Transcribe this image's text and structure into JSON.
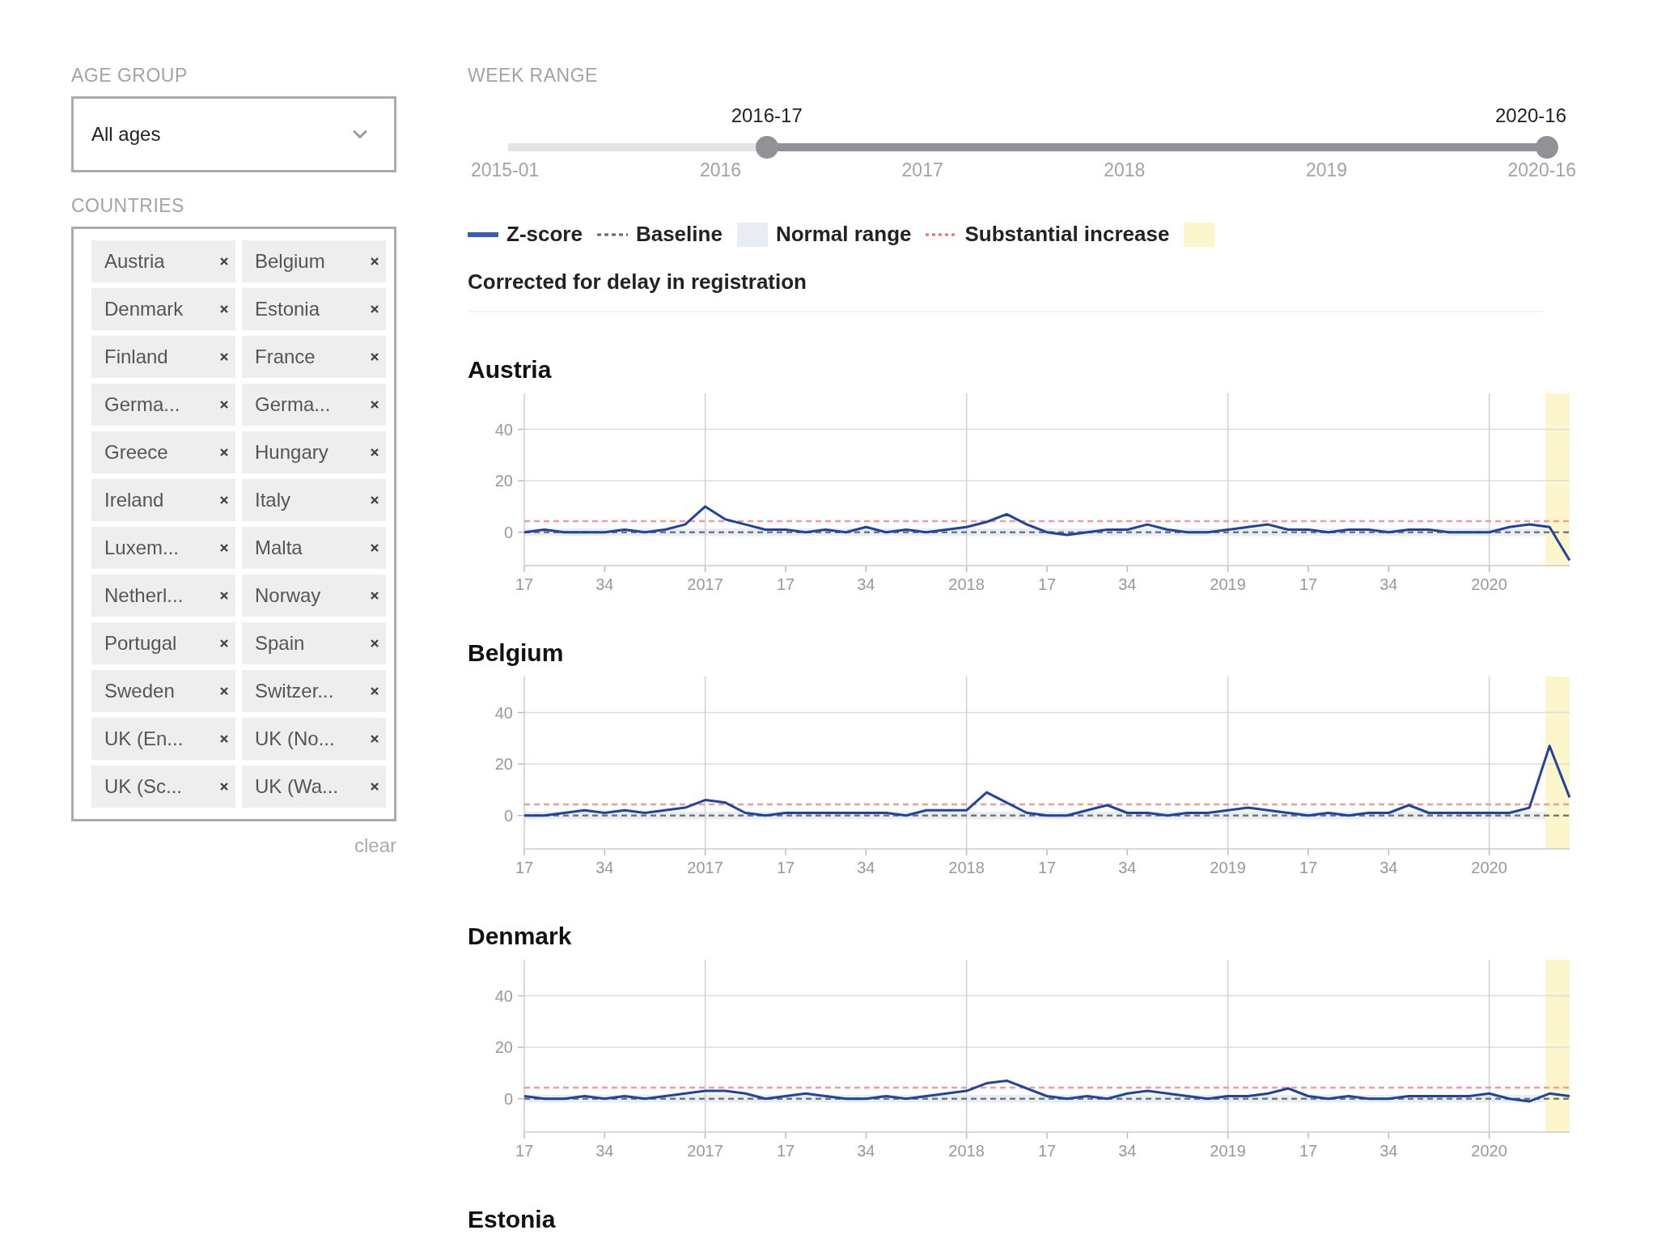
{
  "age_group": {
    "label": "AGE GROUP",
    "value": "All ages"
  },
  "countries": {
    "label": "COUNTRIES",
    "chips": [
      "Austria",
      "Belgium",
      "Denmark",
      "Estonia",
      "Finland",
      "France",
      "Germa...",
      "Germa...",
      "Greece",
      "Hungary",
      "Ireland",
      "Italy",
      "Luxem...",
      "Malta",
      "Netherl...",
      "Norway",
      "Portugal",
      "Spain",
      "Sweden",
      "Switzer...",
      "UK (En...",
      "UK (No...",
      "UK (Sc...",
      "UK (Wa..."
    ],
    "clear": "clear"
  },
  "week_range": {
    "label": "WEEK RANGE",
    "start": {
      "label": "2016-17",
      "level": 0.249
    },
    "end": {
      "label": "2020-16",
      "level": 1
    },
    "ticks": [
      "2015-01",
      "2016",
      "2017",
      "2018",
      "2019",
      "2020-16"
    ]
  },
  "legend": [
    {
      "kind": "line",
      "label": "Z-score",
      "color": "#3a5bb8"
    },
    {
      "kind": "dashed",
      "label": "Baseline",
      "color": "#666666"
    },
    {
      "kind": "swatch",
      "label": "Normal range",
      "color": "#e8edf3"
    },
    {
      "kind": "dotted",
      "label": "Substantial increase",
      "color": "#f06a6a"
    },
    {
      "kind": "swatch",
      "color": "#fdf6cc"
    }
  ],
  "note": "Corrected for delay in registration",
  "panels": [
    {
      "title": "Austria",
      "chart_data": {
        "type": "line",
        "categories": [
          "17",
          null,
          null,
          null,
          "34",
          null,
          null,
          null,
          null,
          "2017",
          null,
          null,
          null,
          "17",
          null,
          null,
          null,
          "34",
          null,
          null,
          null,
          null,
          "2018",
          null,
          null,
          null,
          "17",
          null,
          null,
          null,
          "34",
          null,
          null,
          null,
          null,
          "2019",
          null,
          null,
          null,
          "17",
          null,
          null,
          null,
          "34",
          null,
          null,
          null,
          null,
          "2020",
          null,
          null,
          null,
          null
        ],
        "series": [
          {
            "color": "#1f44a0",
            "values": [
              0,
              1,
              0,
              0,
              0,
              1,
              0,
              1,
              3,
              10,
              5,
              3,
              1,
              1,
              0,
              1,
              0,
              2,
              0,
              1,
              0,
              1,
              2,
              4,
              7,
              3,
              0,
              -1,
              0,
              1,
              1,
              3,
              1,
              0,
              0,
              1,
              2,
              3,
              1,
              1,
              0,
              1,
              1,
              0,
              1,
              1,
              0,
              0,
              0,
              2,
              3,
              2,
              -11
            ]
          }
        ],
        "ylim": [
          -13,
          54
        ],
        "yticks": [
          0,
          20,
          40
        ],
        "grid": true,
        "ref_lines": [
          {
            "axis": "y",
            "value": 0,
            "color": "#777777"
          },
          {
            "axis": "y",
            "value": 4.3,
            "color": "#f39a9a"
          }
        ],
        "bands": [
          {
            "axis": "y",
            "from": -1.5,
            "to": 1.5,
            "color": "#e8edf3"
          }
        ]
      }
    },
    {
      "title": "Belgium",
      "chart_data": {
        "type": "line",
        "categories": [
          "17",
          null,
          null,
          null,
          "34",
          null,
          null,
          null,
          null,
          "2017",
          null,
          null,
          null,
          "17",
          null,
          null,
          null,
          "34",
          null,
          null,
          null,
          null,
          "2018",
          null,
          null,
          null,
          "17",
          null,
          null,
          null,
          "34",
          null,
          null,
          null,
          null,
          "2019",
          null,
          null,
          null,
          "17",
          null,
          null,
          null,
          "34",
          null,
          null,
          null,
          null,
          "2020",
          null,
          null,
          null,
          null
        ],
        "series": [
          {
            "color": "#1f44a0",
            "values": [
              0,
              0,
              1,
              2,
              1,
              2,
              1,
              2,
              3,
              6,
              5,
              1,
              0,
              1,
              1,
              1,
              1,
              1,
              1,
              0,
              2,
              2,
              2,
              9,
              5,
              1,
              0,
              0,
              2,
              4,
              1,
              1,
              0,
              1,
              1,
              2,
              3,
              2,
              1,
              0,
              1,
              0,
              1,
              1,
              4,
              1,
              1,
              1,
              1,
              1,
              3,
              27,
              7
            ]
          }
        ],
        "ylim": [
          -13,
          54
        ],
        "yticks": [
          0,
          20,
          40
        ],
        "grid": true,
        "ref_lines": [
          {
            "axis": "y",
            "value": 0,
            "color": "#777777"
          },
          {
            "axis": "y",
            "value": 4.3,
            "color": "#f39a9a"
          }
        ],
        "bands": [
          {
            "axis": "y",
            "from": -1.5,
            "to": 1.5,
            "color": "#e8edf3"
          }
        ]
      }
    },
    {
      "title": "Denmark",
      "chart_data": {
        "type": "line",
        "categories": [
          "17",
          null,
          null,
          null,
          "34",
          null,
          null,
          null,
          null,
          "2017",
          null,
          null,
          null,
          "17",
          null,
          null,
          null,
          "34",
          null,
          null,
          null,
          null,
          "2018",
          null,
          null,
          null,
          "17",
          null,
          null,
          null,
          "34",
          null,
          null,
          null,
          null,
          "2019",
          null,
          null,
          null,
          "17",
          null,
          null,
          null,
          "34",
          null,
          null,
          null,
          null,
          "2020",
          null,
          null,
          null,
          null
        ],
        "series": [
          {
            "color": "#1f44a0",
            "values": [
              1,
              0,
              0,
              1,
              0,
              1,
              0,
              1,
              2,
              3,
              3,
              2,
              0,
              1,
              2,
              1,
              0,
              0,
              1,
              0,
              1,
              2,
              3,
              6,
              7,
              4,
              1,
              0,
              1,
              0,
              2,
              3,
              2,
              1,
              0,
              1,
              1,
              2,
              4,
              1,
              0,
              1,
              0,
              0,
              1,
              1,
              1,
              1,
              2,
              0,
              -1,
              2,
              1
            ]
          }
        ],
        "ylim": [
          -13,
          54
        ],
        "yticks": [
          0,
          20,
          40
        ],
        "grid": true,
        "ref_lines": [
          {
            "axis": "y",
            "value": 0,
            "color": "#777777"
          },
          {
            "axis": "y",
            "value": 4.3,
            "color": "#f39a9a"
          }
        ],
        "bands": [
          {
            "axis": "y",
            "from": -1.5,
            "to": 1.5,
            "color": "#e8edf3"
          }
        ]
      }
    },
    {
      "title": "Estonia"
    }
  ]
}
